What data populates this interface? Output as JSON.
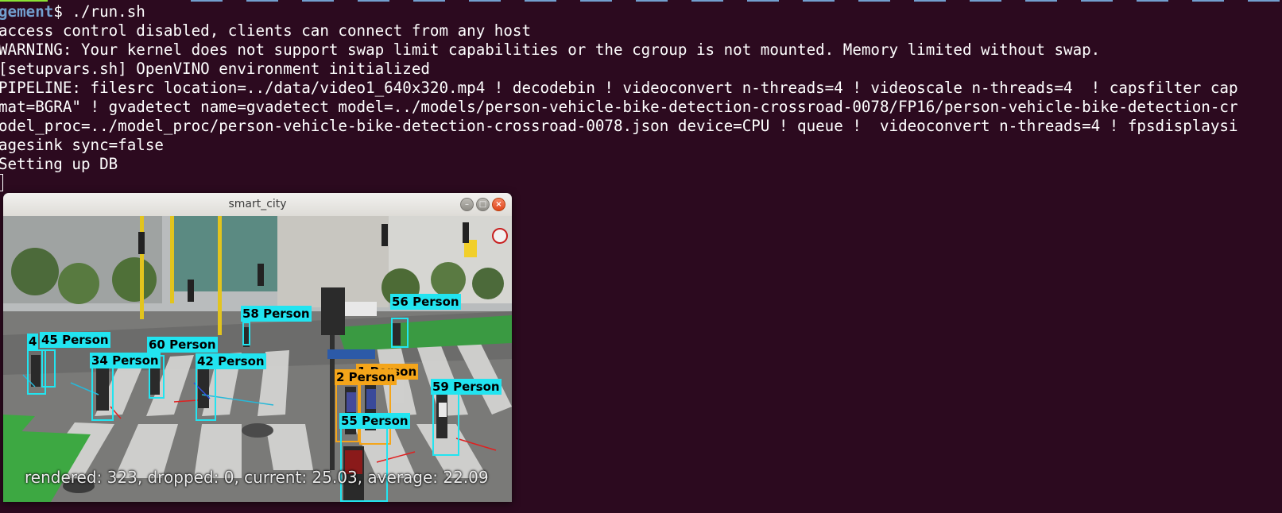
{
  "terminal": {
    "prompt_path": "gement",
    "prompt_cmd": "$ ./run.sh",
    "lines": [
      "access control disabled, clients can connect from any host",
      "WARNING: Your kernel does not support swap limit capabilities or the cgroup is not mounted. Memory limited without swap.",
      "[setupvars.sh] OpenVINO environment initialized",
      "PIPELINE: filesrc location=../data/video1_640x320.mp4 ! decodebin ! videoconvert n-threads=4 ! videoscale n-threads=4  ! capsfilter cap",
      "mat=BGRA\" ! gvadetect name=gvadetect model=../models/person-vehicle-bike-detection-crossroad-0078/FP16/person-vehicle-bike-detection-cr",
      "odel_proc=../model_proc/person-vehicle-bike-detection-crossroad-0078.json device=CPU ! queue !  videoconvert n-threads=4 ! fpsdisplaysi",
      "agesink sync=false",
      "Setting up DB"
    ]
  },
  "window": {
    "title": "smart_city",
    "min_glyph": "–",
    "max_glyph": "□",
    "close_glyph": "×",
    "overlay_text": "rendered: 323, dropped: 0, current: 25.03, average: 22.09",
    "detections": [
      {
        "label": "58 Person",
        "color": "#22e4f0"
      },
      {
        "label": "56 Person",
        "color": "#22e4f0"
      },
      {
        "label": "4",
        "color": "#22e4f0"
      },
      {
        "label": "45 Person",
        "color": "#22e4f0"
      },
      {
        "label": "60 Person",
        "color": "#22e4f0"
      },
      {
        "label": "34 Person",
        "color": "#22e4f0"
      },
      {
        "label": "42 Person",
        "color": "#22e4f0"
      },
      {
        "label": "1 Person",
        "color": "#f4a51a"
      },
      {
        "label": "2 Person",
        "color": "#f4a51a"
      },
      {
        "label": "59 Person",
        "color": "#22e4f0"
      },
      {
        "label": "55 Person",
        "color": "#22e4f0"
      }
    ]
  },
  "colors": {
    "terminal_bg": "#2c0a1f",
    "prompt_path": "#729fcf",
    "box_cyan": "#22e4f0",
    "box_orange": "#f4a51a"
  }
}
